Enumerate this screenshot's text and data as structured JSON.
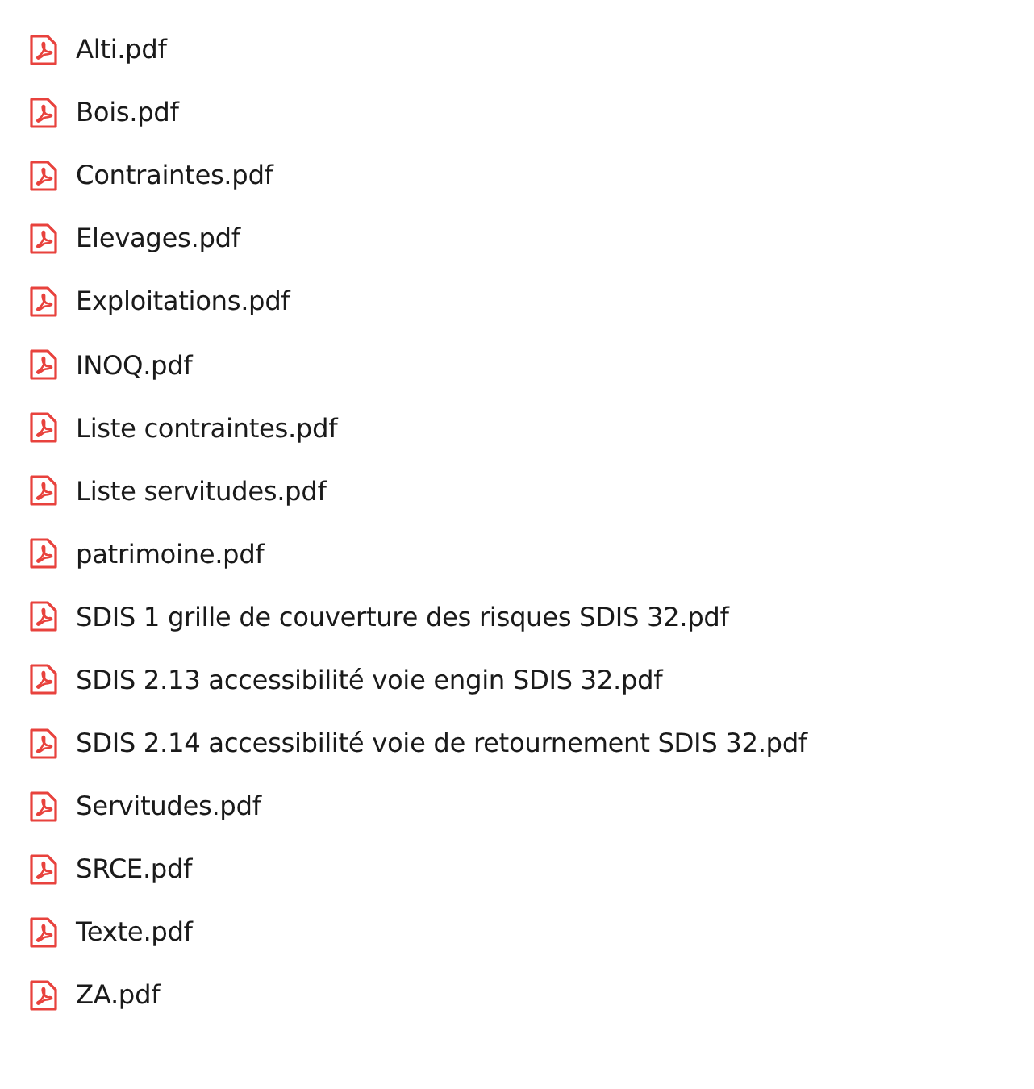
{
  "files": [
    {
      "name": "Alti.pdf"
    },
    {
      "name": "Bois.pdf"
    },
    {
      "name": "Contraintes.pdf"
    },
    {
      "name": "Elevages.pdf"
    },
    {
      "name": "Exploitations.pdf"
    },
    {
      "name": "INOQ.pdf"
    },
    {
      "name": "Liste contraintes.pdf"
    },
    {
      "name": "Liste servitudes.pdf"
    },
    {
      "name": "patrimoine.pdf"
    },
    {
      "name": "SDIS 1 grille de couverture des risques SDIS 32.pdf"
    },
    {
      "name": "SDIS 2.13 accessibilité voie engin SDIS 32.pdf"
    },
    {
      "name": "SDIS 2.14 accessibilité voie de retournement SDIS 32.pdf"
    },
    {
      "name": "Servitudes.pdf"
    },
    {
      "name": "SRCE.pdf"
    },
    {
      "name": "Texte.pdf"
    },
    {
      "name": "ZA.pdf"
    }
  ]
}
